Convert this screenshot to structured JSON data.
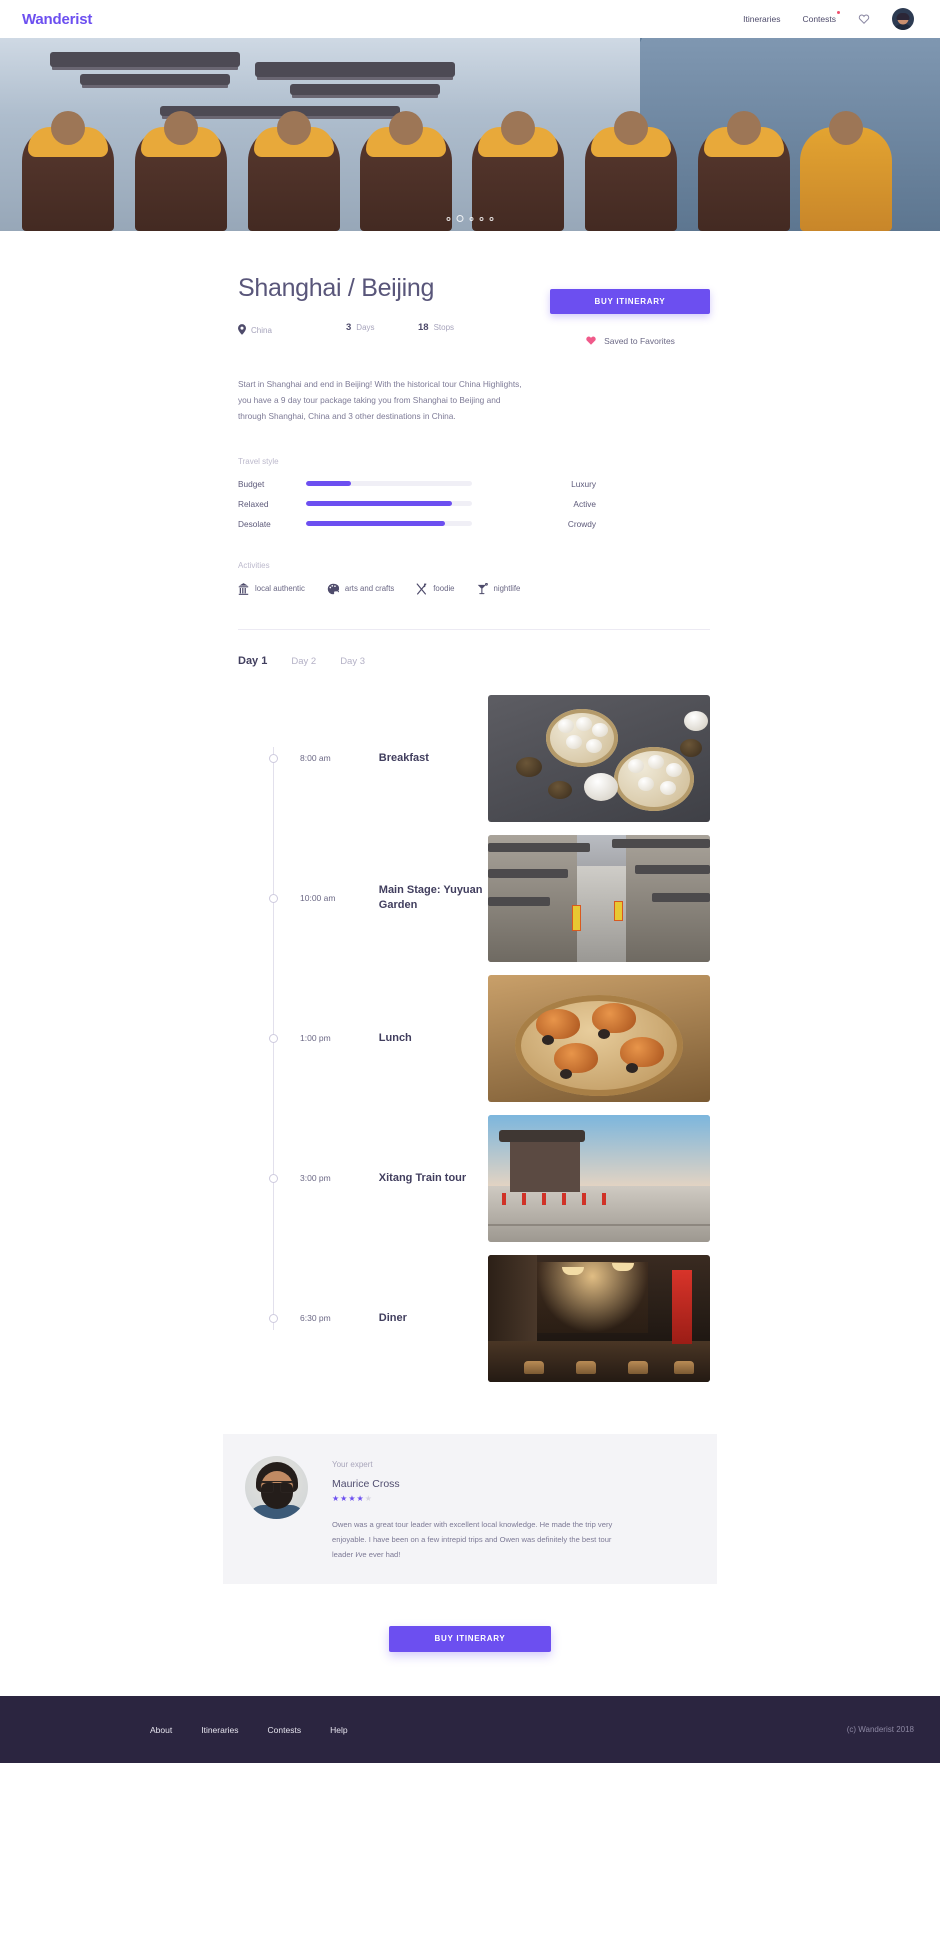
{
  "header": {
    "brand": "Wanderist",
    "nav": [
      {
        "label": "Itineraries",
        "badge": false
      },
      {
        "label": "Contests",
        "badge": true
      }
    ],
    "favorites_icon": "heart-icon",
    "avatar_icon": "user-avatar"
  },
  "hero": {
    "image_alt": "monks-facing-temple",
    "carousel_dots": 5,
    "active_dot": 2
  },
  "trip": {
    "title": "Shanghai / Beijing",
    "country": "China",
    "location_icon": "map-pin-icon",
    "days_value": "3",
    "days_label": "Days",
    "stops_value": "18",
    "stops_label": "Stops",
    "description": "Start in Shanghai and end in Beijing! With the historical tour China Highlights, you have a 9 day tour package taking you from Shanghai to Beijing and through Shanghai, China and 3 other destinations in China.",
    "buy_label": "BUY ITINERARY",
    "saved_label": "Saved to Favorites",
    "saved_icon": "heart-filled-icon"
  },
  "travel_style": {
    "label": "Travel style",
    "accent": "#6c4ff0",
    "track": "#f0eff6",
    "sliders": [
      {
        "left": "Budget",
        "right": "Luxury",
        "value": 27
      },
      {
        "left": "Relaxed",
        "right": "Active",
        "value": 88
      },
      {
        "left": "Desolate",
        "right": "Crowdy",
        "value": 84
      }
    ]
  },
  "activities": {
    "label": "Activities",
    "items": [
      {
        "name": "local authentic",
        "icon": "museum-icon"
      },
      {
        "name": "arts and crafts",
        "icon": "palette-icon"
      },
      {
        "name": "foodie",
        "icon": "fork-knife-icon"
      },
      {
        "name": "nightlife",
        "icon": "cocktail-icon"
      }
    ]
  },
  "days": {
    "tabs": [
      {
        "label": "Day 1",
        "active": true
      },
      {
        "label": "Day 2",
        "active": false
      },
      {
        "label": "Day 3",
        "active": false
      }
    ]
  },
  "itinerary": [
    {
      "time": "8:00 am",
      "name": "Breakfast",
      "photo": "dim-sum-baskets"
    },
    {
      "time": "10:00 am",
      "name": "Main Stage: Yuyuan Garden",
      "photo": "old-street-alley"
    },
    {
      "time": "1:00 pm",
      "name": "Lunch",
      "photo": "steamed-crabs"
    },
    {
      "time": "3:00 pm",
      "name": "Xitang Train tour",
      "photo": "city-wall-gate"
    },
    {
      "time": "6:30 pm",
      "name": "Diner",
      "photo": "market-hall-interior"
    }
  ],
  "expert": {
    "label": "Your expert",
    "name": "Maurice Cross",
    "rating": 4,
    "rating_max": 5,
    "review": "Owen was a great tour leader with excellent local knowledge. He made the trip very enjoyable. I have been on a few intrepid trips and Owen was definitely the best tour leader I⁄ve ever had!"
  },
  "bottom_cta": {
    "label": "BUY ITINERARY"
  },
  "footer": {
    "links": [
      "About",
      "Itineraries",
      "Contests",
      "Help"
    ],
    "copyright": "(c) Wanderist 2018",
    "background": "#2b2540"
  }
}
